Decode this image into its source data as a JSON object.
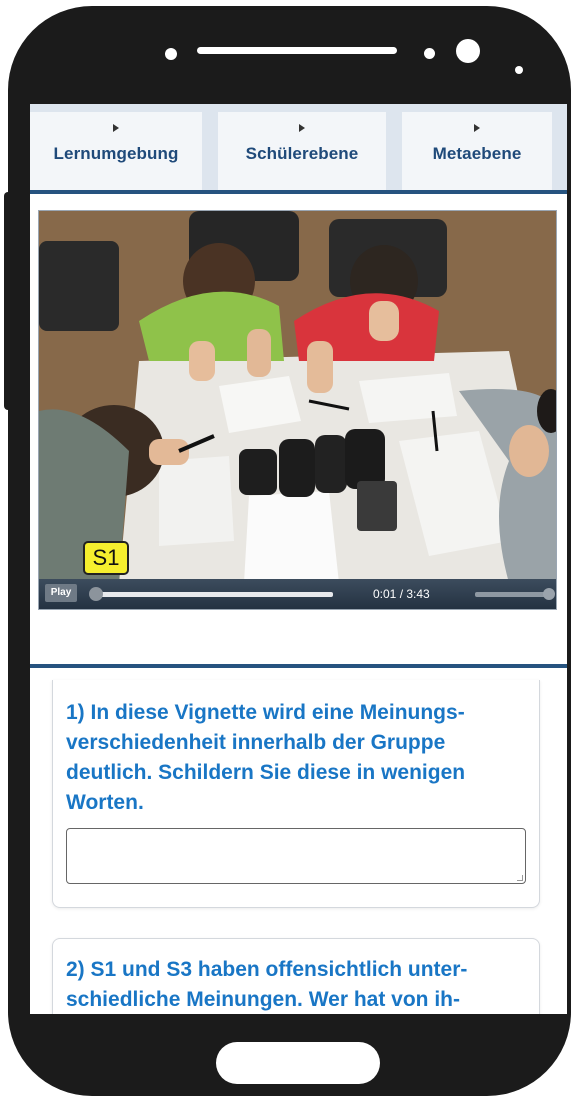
{
  "tabs": [
    {
      "label": "Lernumgebung"
    },
    {
      "label": "Schülerebene"
    },
    {
      "label": "Metaebene"
    }
  ],
  "video": {
    "badge": "S1",
    "play_label": "Play",
    "time_display": "0:01 / 3:43",
    "progress_fraction": 0.005,
    "volume_fraction": 1.0
  },
  "questions": [
    {
      "text": "1) In diese Vignette wird eine Meinungs-verschiedenheit innerhalb der Gruppe deutlich. Schildern Sie diese in wenigen Worten.",
      "answer_value": ""
    },
    {
      "text": "2) S1 und S3 haben offensichtlich unter-schiedliche Meinungen. Wer hat von ih-"
    }
  ],
  "colors": {
    "phone_frame": "#1b1b1b",
    "tab_text": "#1f4a7a",
    "accent_rule": "#26537f",
    "question_text": "#1976c5",
    "badge_bg": "#f6ef2e"
  }
}
